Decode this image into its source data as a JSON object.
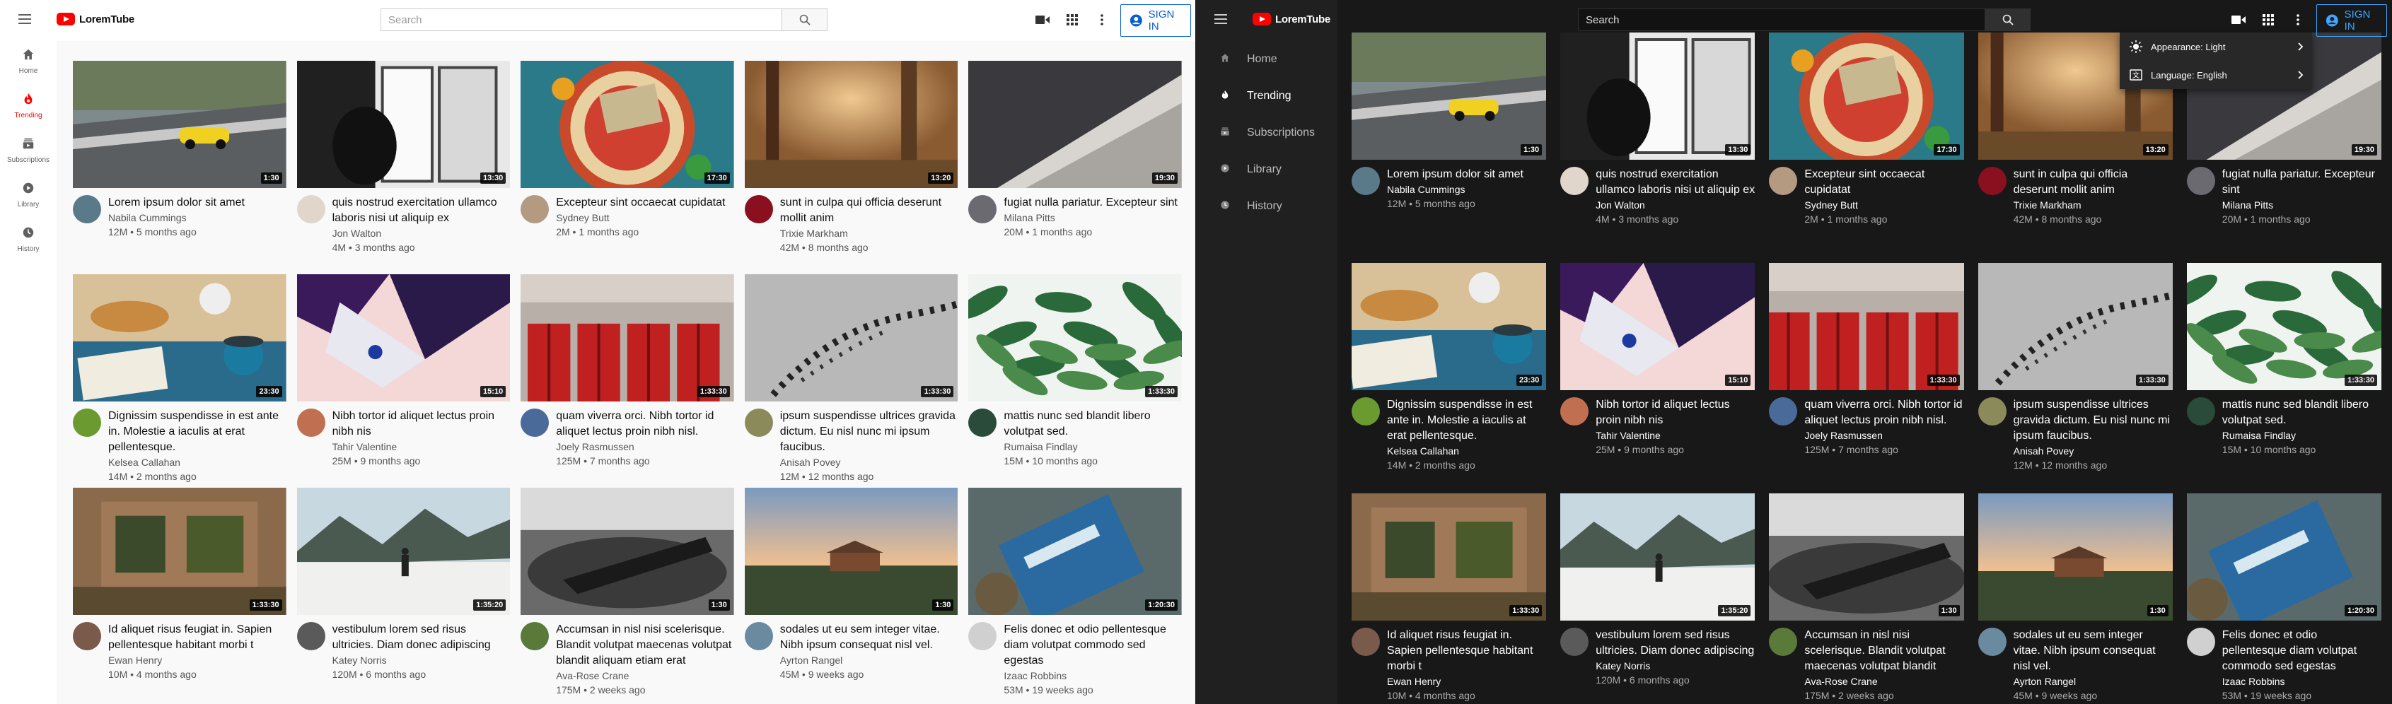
{
  "app": {
    "logo_text": "LoremTube",
    "search_placeholder": "Search",
    "signin_label": "SIGN IN",
    "brand_color": "#ff0000",
    "accent_color": "#065fd4"
  },
  "light_sidebar": [
    {
      "label": "Home",
      "icon": "home-icon"
    },
    {
      "label": "Trending",
      "icon": "fire-icon",
      "active": true
    },
    {
      "label": "Subscriptions",
      "icon": "subscriptions-icon"
    },
    {
      "label": "Library",
      "icon": "library-icon"
    },
    {
      "label": "History",
      "icon": "history-icon"
    }
  ],
  "dark_sidebar": [
    {
      "label": "Home",
      "icon": "home-icon"
    },
    {
      "label": "Trending",
      "icon": "fire-icon",
      "active": true
    },
    {
      "label": "Subscriptions",
      "icon": "subscriptions-icon"
    },
    {
      "label": "Library",
      "icon": "library-icon"
    },
    {
      "label": "History",
      "icon": "history-icon"
    }
  ],
  "settings_menu": {
    "appearance": "Appearance: Light",
    "language": "Language: English"
  },
  "light_videos": [
    {
      "title": "Lorem ipsum dolor sit amet",
      "channel": "Nabila Cummings",
      "stats": "12M • 5 months ago",
      "duration": "1:30",
      "thumb": "car",
      "avatar": "#5a7a8a"
    },
    {
      "title": "quis nostrud exercitation ullamco laboris nisi ut aliquip ex",
      "channel": "Jon Walton",
      "stats": "4M • 3 months ago",
      "duration": "13:30",
      "thumb": "window",
      "avatar": "#e0d6cc"
    },
    {
      "title": "Excepteur sint occaecat cupidatat",
      "channel": "Sydney Butt",
      "stats": "2M • 1 months ago",
      "duration": "17:30",
      "thumb": "plate",
      "avatar": "#b39a80"
    },
    {
      "title": "sunt in culpa qui officia deserunt mollit anim",
      "channel": "Trixie Markham",
      "stats": "42M • 8 months ago",
      "duration": "13:20",
      "thumb": "forest",
      "avatar": "#8a1020"
    },
    {
      "title": "fugiat nulla pariatur. Excepteur sint",
      "channel": "Milana Pitts",
      "stats": "20M • 1 months ago",
      "duration": "19:30",
      "thumb": "snow",
      "avatar": "#6a6a70"
    },
    {
      "title": "Dignissim suspendisse in est ante in. Molestie a iaculis at erat pellentesque.",
      "channel": "Kelsea Callahan",
      "stats": "14M • 2 months ago",
      "duration": "23:30",
      "thumb": "breakfast",
      "avatar": "#6a9a30"
    },
    {
      "title": "Nibh tortor id aliquet lectus proin nibh nis",
      "channel": "Tahir Valentine",
      "stats": "25M • 9 months ago",
      "duration": "15:10",
      "thumb": "scarf",
      "avatar": "#c07050"
    },
    {
      "title": "quam viverra orci. Nibh tortor id aliquet lectus proin nibh nisl.",
      "channel": "Joely Rasmussen",
      "stats": "125M • 7 months ago",
      "duration": "1:33:30",
      "thumb": "doors",
      "avatar": "#4a6a9a"
    },
    {
      "title": "ipsum suspendisse ultrices gravida dictum. Eu nisl nunc mi ipsum faucibus.",
      "channel": "Anisah Povey",
      "stats": "12M • 12 months ago",
      "duration": "1:33:30",
      "thumb": "birds",
      "avatar": "#8a8a5a"
    },
    {
      "title": "mattis nunc sed blandit libero volutpat sed.",
      "channel": "Rumaisa Findlay",
      "stats": "15M • 10 months ago",
      "duration": "1:33:30",
      "thumb": "fern",
      "avatar": "#2a4a3a"
    },
    {
      "title": "Id aliquet risus feugiat in. Sapien pellentesque habitant morbi t",
      "channel": "Ewan Henry",
      "stats": "10M • 4 months ago",
      "duration": "1:33:30",
      "thumb": "ruin",
      "avatar": "#7a5a4a"
    },
    {
      "title": "vestibulum lorem sed risus ultricies. Diam donec adipiscing",
      "channel": "Katey Norris",
      "stats": "120M • 6 months ago",
      "duration": "1:35:20",
      "thumb": "hiker",
      "avatar": "#5a5a5a"
    },
    {
      "title": "Accumsan in nisl nisi scelerisque. Blandit volutpat maecenas volutpat blandit aliquam etiam erat",
      "channel": "Ava-Rose Crane",
      "stats": "175M • 2 weeks ago",
      "duration": "1:30",
      "thumb": "boat",
      "avatar": "#5a7a3a"
    },
    {
      "title": "sodales ut eu sem integer vitae. Nibh ipsum consequat nisl vel.",
      "channel": "Ayrton Rangel",
      "stats": "45M • 9 weeks ago",
      "duration": "1:30",
      "thumb": "coast",
      "avatar": "#6a8aa0"
    },
    {
      "title": "Felis donec et odio pellentesque diam volutpat commodo sed egestas",
      "channel": "Izaac Robbins",
      "stats": "53M • 19 weeks ago",
      "duration": "1:20:30",
      "thumb": "sign",
      "avatar": "#d0d0d0"
    }
  ],
  "dark_videos": [
    {
      "title": "Lorem ipsum dolor sit amet",
      "channel": "Nabila Cummings",
      "stats": "12M • 5 months ago",
      "duration": "1:30",
      "thumb": "car",
      "avatar": "#5a7a8a"
    },
    {
      "title": "quis nostrud exercitation ullamco laboris nisi ut aliquip ex",
      "channel": "Jon Walton",
      "stats": "4M • 3 months ago",
      "duration": "13:30",
      "thumb": "window",
      "avatar": "#e0d6cc"
    },
    {
      "title": "Excepteur sint occaecat cupidatat",
      "channel": "Sydney Butt",
      "stats": "2M • 1 months ago",
      "duration": "17:30",
      "thumb": "plate",
      "avatar": "#b39a80"
    },
    {
      "title": "sunt in culpa qui officia deserunt mollit anim",
      "channel": "Trixie Markham",
      "stats": "42M • 8 months ago",
      "duration": "13:20",
      "thumb": "forest",
      "avatar": "#8a1020"
    },
    {
      "title": "fugiat nulla pariatur. Excepteur sint",
      "channel": "Milana Pitts",
      "stats": "20M • 1 months ago",
      "duration": "19:30",
      "thumb": "snow",
      "avatar": "#6a6a70"
    },
    {
      "title": "Dignissim suspendisse in est ante in. Molestie a iaculis at erat pellentesque.",
      "channel": "Kelsea Callahan",
      "stats": "14M • 2 months ago",
      "duration": "23:30",
      "thumb": "breakfast",
      "avatar": "#6a9a30"
    },
    {
      "title": "Nibh tortor id aliquet lectus proin nibh nis",
      "channel": "Tahir Valentine",
      "stats": "25M • 9 months ago",
      "duration": "15:10",
      "thumb": "scarf",
      "avatar": "#c07050"
    },
    {
      "title": "quam viverra orci. Nibh tortor id aliquet lectus proin nibh nisl.",
      "channel": "Joely Rasmussen",
      "stats": "125M • 7 months ago",
      "duration": "1:33:30",
      "thumb": "doors",
      "avatar": "#4a6a9a"
    },
    {
      "title": "ipsum suspendisse ultrices gravida dictum. Eu nisl nunc mi ipsum faucibus.",
      "channel": "Anisah Povey",
      "stats": "12M • 12 months ago",
      "duration": "1:33:30",
      "thumb": "birds",
      "avatar": "#8a8a5a"
    },
    {
      "title": "mattis nunc sed blandit libero volutpat sed.",
      "channel": "Rumaisa Findlay",
      "stats": "15M • 10 months ago",
      "duration": "1:33:30",
      "thumb": "fern",
      "avatar": "#2a4a3a"
    },
    {
      "title": "Id aliquet risus feugiat in. Sapien pellentesque habitant morbi t",
      "channel": "Ewan Henry",
      "stats": "10M • 4 months ago",
      "duration": "1:33:30",
      "thumb": "ruin",
      "avatar": "#7a5a4a"
    },
    {
      "title": "vestibulum lorem sed risus ultricies. Diam donec adipiscing",
      "channel": "Katey Norris",
      "stats": "120M • 6 months ago",
      "duration": "1:35:20",
      "thumb": "hiker",
      "avatar": "#5a5a5a"
    },
    {
      "title": "Accumsan in nisl nisi scelerisque. Blandit volutpat maecenas volutpat blandit aliquam etiam erat",
      "channel": "Ava-Rose Crane",
      "stats": "175M • 2 weeks ago",
      "duration": "1:30",
      "thumb": "boat",
      "avatar": "#5a7a3a"
    },
    {
      "title": "sodales ut eu sem integer vitae. Nibh ipsum consequat nisl vel.",
      "channel": "Ayrton Rangel",
      "stats": "45M • 9 weeks ago",
      "duration": "1:30",
      "thumb": "coast",
      "avatar": "#6a8aa0"
    },
    {
      "title": "Felis donec et odio pellentesque diam volutpat commodo sed egestas",
      "channel": "Izaac Robbins",
      "stats": "53M • 19 weeks ago",
      "duration": "1:20:30",
      "thumb": "sign",
      "avatar": "#d0d0d0"
    }
  ]
}
